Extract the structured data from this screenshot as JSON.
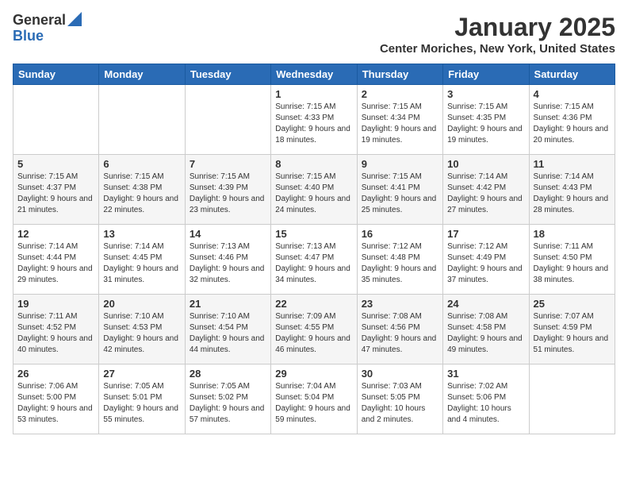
{
  "logo": {
    "general": "General",
    "blue": "Blue"
  },
  "title": "January 2025",
  "location": "Center Moriches, New York, United States",
  "days_of_week": [
    "Sunday",
    "Monday",
    "Tuesday",
    "Wednesday",
    "Thursday",
    "Friday",
    "Saturday"
  ],
  "weeks": [
    [
      {
        "day": "",
        "sunrise": "",
        "sunset": "",
        "daylight": ""
      },
      {
        "day": "",
        "sunrise": "",
        "sunset": "",
        "daylight": ""
      },
      {
        "day": "",
        "sunrise": "",
        "sunset": "",
        "daylight": ""
      },
      {
        "day": "1",
        "sunrise": "Sunrise: 7:15 AM",
        "sunset": "Sunset: 4:33 PM",
        "daylight": "Daylight: 9 hours and 18 minutes."
      },
      {
        "day": "2",
        "sunrise": "Sunrise: 7:15 AM",
        "sunset": "Sunset: 4:34 PM",
        "daylight": "Daylight: 9 hours and 19 minutes."
      },
      {
        "day": "3",
        "sunrise": "Sunrise: 7:15 AM",
        "sunset": "Sunset: 4:35 PM",
        "daylight": "Daylight: 9 hours and 19 minutes."
      },
      {
        "day": "4",
        "sunrise": "Sunrise: 7:15 AM",
        "sunset": "Sunset: 4:36 PM",
        "daylight": "Daylight: 9 hours and 20 minutes."
      }
    ],
    [
      {
        "day": "5",
        "sunrise": "Sunrise: 7:15 AM",
        "sunset": "Sunset: 4:37 PM",
        "daylight": "Daylight: 9 hours and 21 minutes."
      },
      {
        "day": "6",
        "sunrise": "Sunrise: 7:15 AM",
        "sunset": "Sunset: 4:38 PM",
        "daylight": "Daylight: 9 hours and 22 minutes."
      },
      {
        "day": "7",
        "sunrise": "Sunrise: 7:15 AM",
        "sunset": "Sunset: 4:39 PM",
        "daylight": "Daylight: 9 hours and 23 minutes."
      },
      {
        "day": "8",
        "sunrise": "Sunrise: 7:15 AM",
        "sunset": "Sunset: 4:40 PM",
        "daylight": "Daylight: 9 hours and 24 minutes."
      },
      {
        "day": "9",
        "sunrise": "Sunrise: 7:15 AM",
        "sunset": "Sunset: 4:41 PM",
        "daylight": "Daylight: 9 hours and 25 minutes."
      },
      {
        "day": "10",
        "sunrise": "Sunrise: 7:14 AM",
        "sunset": "Sunset: 4:42 PM",
        "daylight": "Daylight: 9 hours and 27 minutes."
      },
      {
        "day": "11",
        "sunrise": "Sunrise: 7:14 AM",
        "sunset": "Sunset: 4:43 PM",
        "daylight": "Daylight: 9 hours and 28 minutes."
      }
    ],
    [
      {
        "day": "12",
        "sunrise": "Sunrise: 7:14 AM",
        "sunset": "Sunset: 4:44 PM",
        "daylight": "Daylight: 9 hours and 29 minutes."
      },
      {
        "day": "13",
        "sunrise": "Sunrise: 7:14 AM",
        "sunset": "Sunset: 4:45 PM",
        "daylight": "Daylight: 9 hours and 31 minutes."
      },
      {
        "day": "14",
        "sunrise": "Sunrise: 7:13 AM",
        "sunset": "Sunset: 4:46 PM",
        "daylight": "Daylight: 9 hours and 32 minutes."
      },
      {
        "day": "15",
        "sunrise": "Sunrise: 7:13 AM",
        "sunset": "Sunset: 4:47 PM",
        "daylight": "Daylight: 9 hours and 34 minutes."
      },
      {
        "day": "16",
        "sunrise": "Sunrise: 7:12 AM",
        "sunset": "Sunset: 4:48 PM",
        "daylight": "Daylight: 9 hours and 35 minutes."
      },
      {
        "day": "17",
        "sunrise": "Sunrise: 7:12 AM",
        "sunset": "Sunset: 4:49 PM",
        "daylight": "Daylight: 9 hours and 37 minutes."
      },
      {
        "day": "18",
        "sunrise": "Sunrise: 7:11 AM",
        "sunset": "Sunset: 4:50 PM",
        "daylight": "Daylight: 9 hours and 38 minutes."
      }
    ],
    [
      {
        "day": "19",
        "sunrise": "Sunrise: 7:11 AM",
        "sunset": "Sunset: 4:52 PM",
        "daylight": "Daylight: 9 hours and 40 minutes."
      },
      {
        "day": "20",
        "sunrise": "Sunrise: 7:10 AM",
        "sunset": "Sunset: 4:53 PM",
        "daylight": "Daylight: 9 hours and 42 minutes."
      },
      {
        "day": "21",
        "sunrise": "Sunrise: 7:10 AM",
        "sunset": "Sunset: 4:54 PM",
        "daylight": "Daylight: 9 hours and 44 minutes."
      },
      {
        "day": "22",
        "sunrise": "Sunrise: 7:09 AM",
        "sunset": "Sunset: 4:55 PM",
        "daylight": "Daylight: 9 hours and 46 minutes."
      },
      {
        "day": "23",
        "sunrise": "Sunrise: 7:08 AM",
        "sunset": "Sunset: 4:56 PM",
        "daylight": "Daylight: 9 hours and 47 minutes."
      },
      {
        "day": "24",
        "sunrise": "Sunrise: 7:08 AM",
        "sunset": "Sunset: 4:58 PM",
        "daylight": "Daylight: 9 hours and 49 minutes."
      },
      {
        "day": "25",
        "sunrise": "Sunrise: 7:07 AM",
        "sunset": "Sunset: 4:59 PM",
        "daylight": "Daylight: 9 hours and 51 minutes."
      }
    ],
    [
      {
        "day": "26",
        "sunrise": "Sunrise: 7:06 AM",
        "sunset": "Sunset: 5:00 PM",
        "daylight": "Daylight: 9 hours and 53 minutes."
      },
      {
        "day": "27",
        "sunrise": "Sunrise: 7:05 AM",
        "sunset": "Sunset: 5:01 PM",
        "daylight": "Daylight: 9 hours and 55 minutes."
      },
      {
        "day": "28",
        "sunrise": "Sunrise: 7:05 AM",
        "sunset": "Sunset: 5:02 PM",
        "daylight": "Daylight: 9 hours and 57 minutes."
      },
      {
        "day": "29",
        "sunrise": "Sunrise: 7:04 AM",
        "sunset": "Sunset: 5:04 PM",
        "daylight": "Daylight: 9 hours and 59 minutes."
      },
      {
        "day": "30",
        "sunrise": "Sunrise: 7:03 AM",
        "sunset": "Sunset: 5:05 PM",
        "daylight": "Daylight: 10 hours and 2 minutes."
      },
      {
        "day": "31",
        "sunrise": "Sunrise: 7:02 AM",
        "sunset": "Sunset: 5:06 PM",
        "daylight": "Daylight: 10 hours and 4 minutes."
      },
      {
        "day": "",
        "sunrise": "",
        "sunset": "",
        "daylight": ""
      }
    ]
  ]
}
